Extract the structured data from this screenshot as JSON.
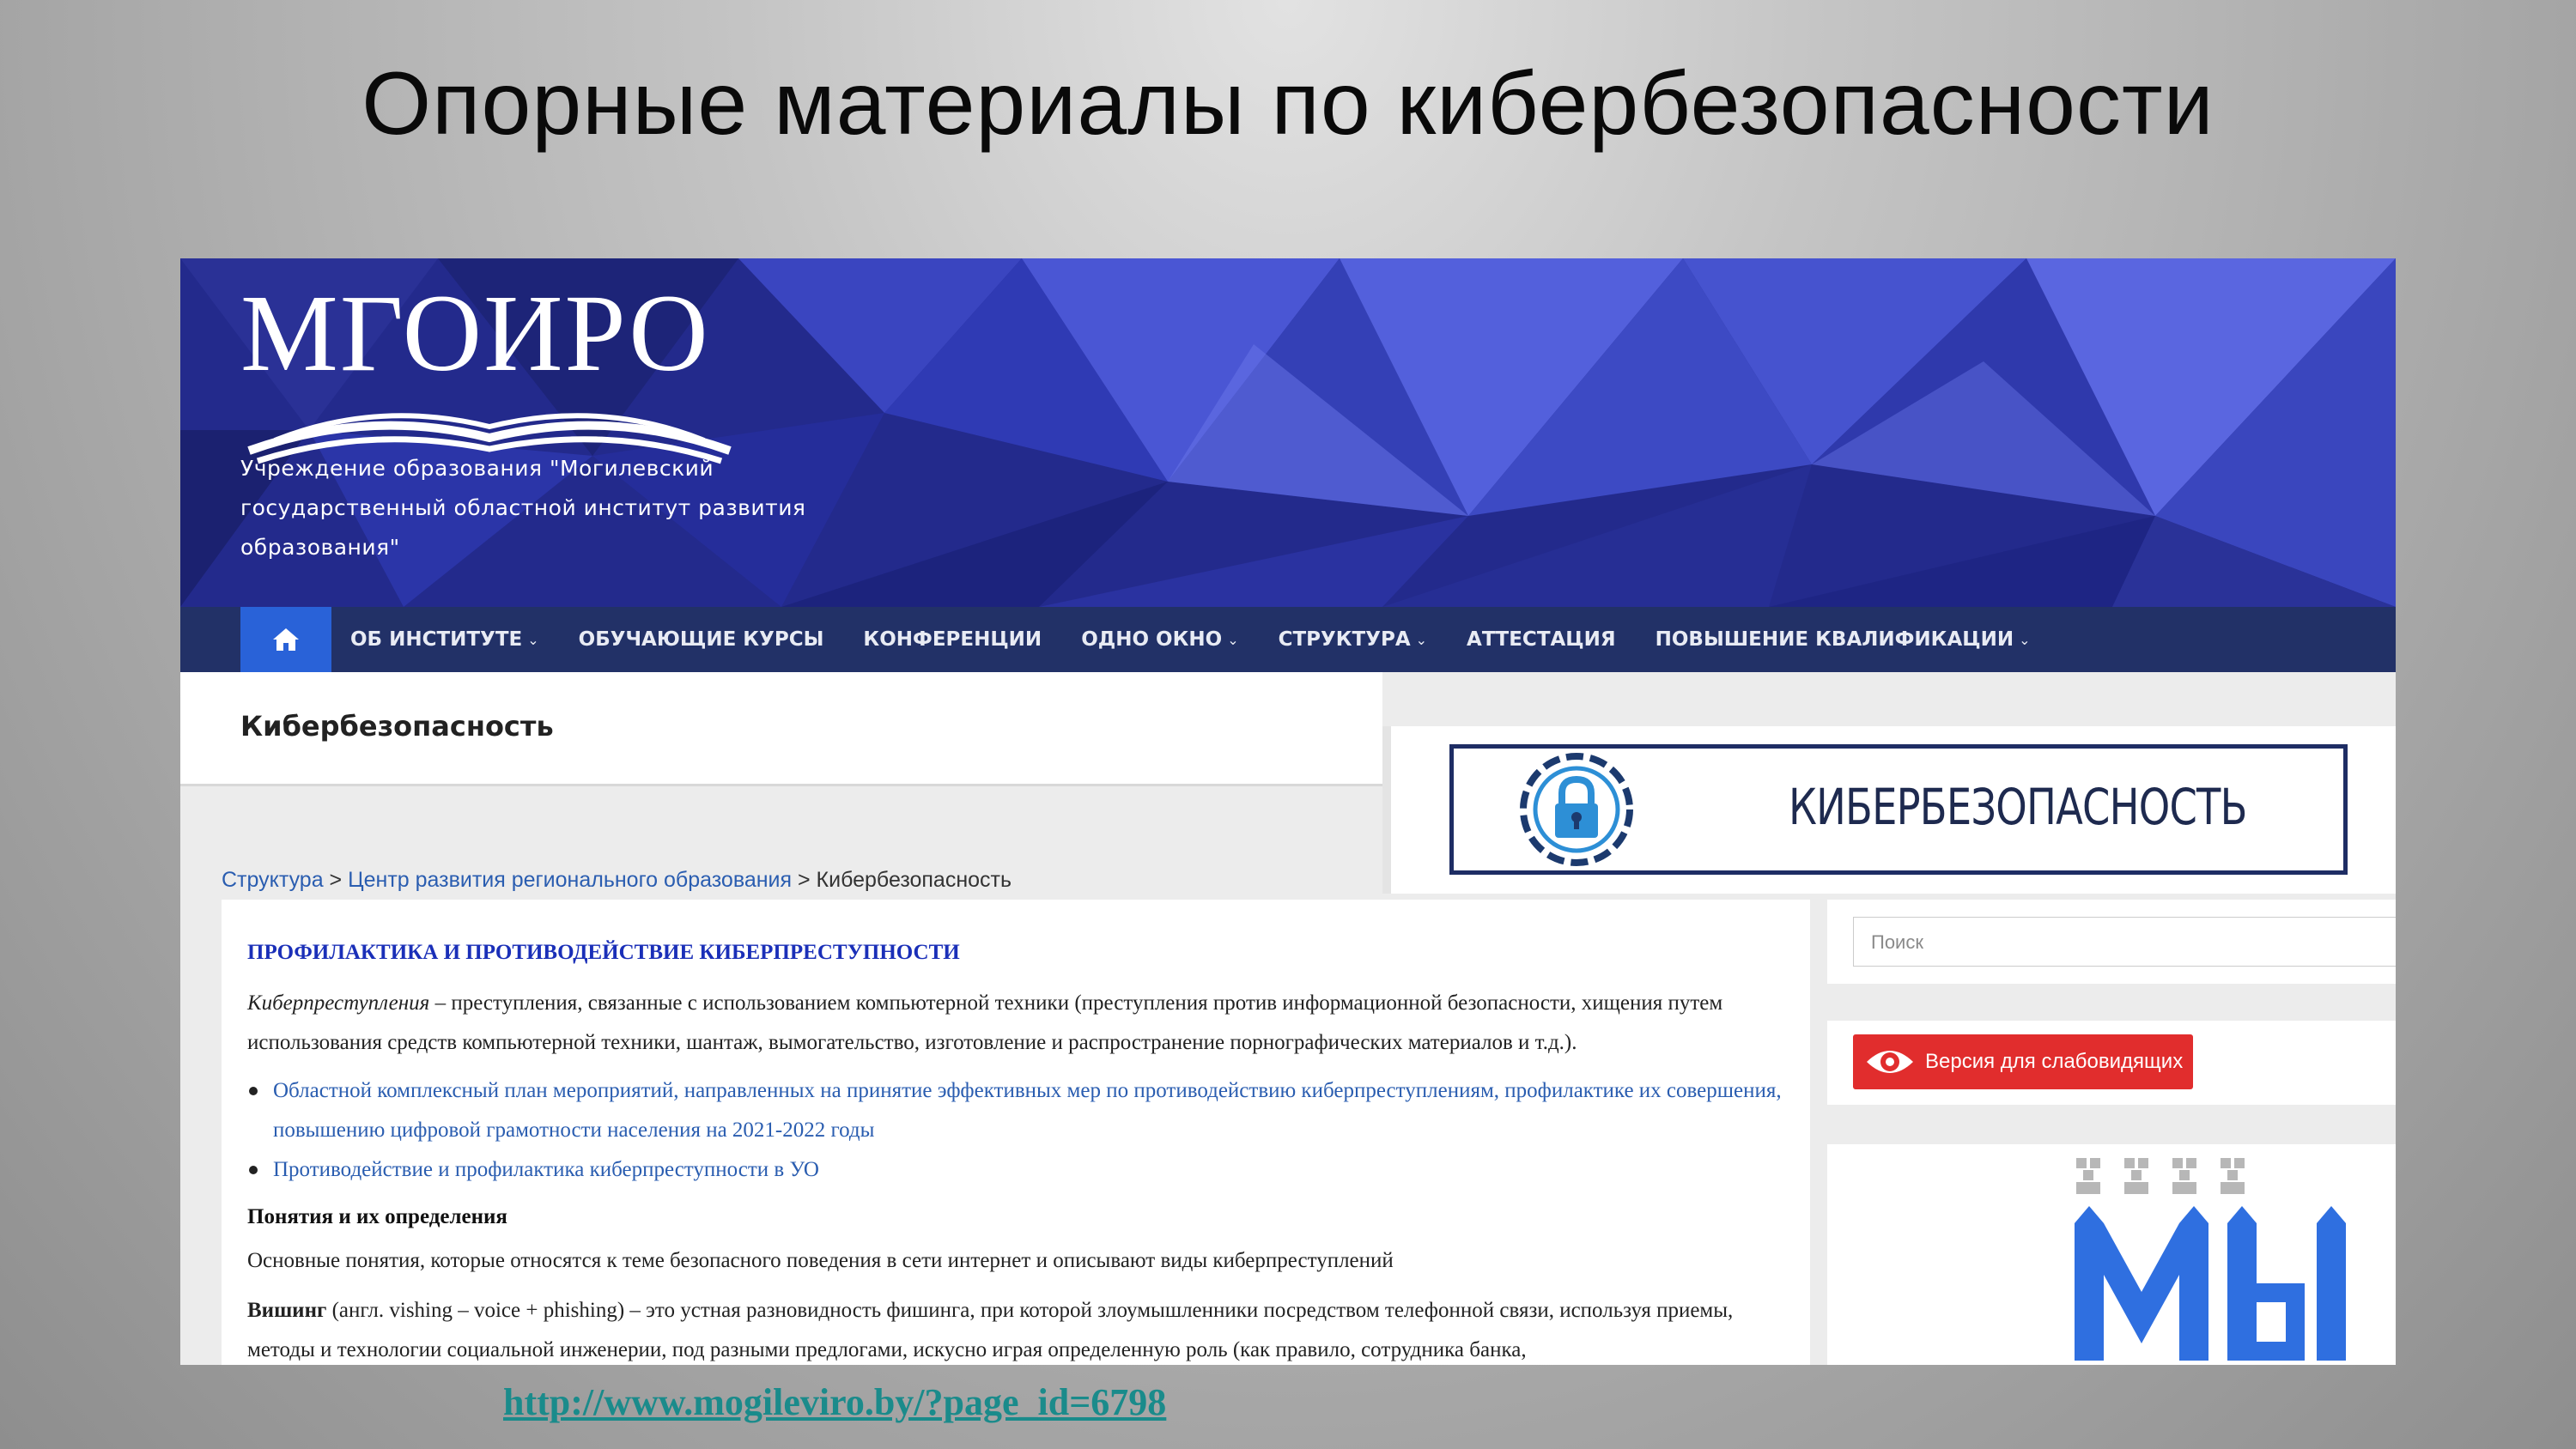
{
  "slide": {
    "title": "Опорные материалы по кибербезопасности",
    "url": "http://www.mogileviro.by/?page_id=6798"
  },
  "site": {
    "logo_text": "МГОИРО",
    "tagline": "Учреждение образования \"Могилевский государственный областной институт развития образования\"",
    "nav": {
      "home_icon": "home-icon",
      "items": [
        {
          "label": "ОБ ИНСТИТУТЕ",
          "dropdown": true
        },
        {
          "label": "ОБУЧАЮЩИЕ КУРСЫ",
          "dropdown": false
        },
        {
          "label": "КОНФЕРЕНЦИИ",
          "dropdown": false
        },
        {
          "label": "ОДНО ОКНО",
          "dropdown": true
        },
        {
          "label": "СТРУКТУРА",
          "dropdown": true
        },
        {
          "label": "АТТЕСТАЦИЯ",
          "dropdown": false
        },
        {
          "label": "ПОВЫШЕНИЕ КВАЛИФИКАЦИИ",
          "dropdown": true
        }
      ],
      "chevron": "⌄"
    },
    "page_title": "Кибербезопасность",
    "breadcrumb": {
      "items": [
        "Структура",
        "Центр развития регионального образования",
        "Кибербезопасность"
      ],
      "separator": " > "
    },
    "banner_text": "КИБЕРБЕЗОПАСНОСТЬ",
    "content": {
      "heading": "ПРОФИЛАКТИКА И ПРОТИВОДЕЙСТВИЕ КИБЕРПРЕСТУПНОСТИ",
      "intro_term": "Киберпреступления",
      "intro_text": " – преступления, связанные с использованием компьютерной техники (преступления против информационной безопасности, хищения путем использования средств компьютерной техники, шантаж, вымогательство, изготовление и распространение порнографических материалов и т.д.).",
      "links": [
        "Областной комплексный план мероприятий, направленных на принятие эффективных мер по противодействию киберпреступлениям, профилактике их совершения, повышению цифровой грамотности населения на 2021-2022 годы",
        "Противодействие и профилактика киберпреступности в УО"
      ],
      "concepts_heading": "Понятия и их определения",
      "concepts_text": "Основные понятия, которые относятся к теме безопасного поведения в сети интернет и описывают виды киберпреступлений",
      "vishing_term": "Вишинг",
      "vishing_text": " (англ. vishing – voice + phishing) – это устная разновидность фишинга, при которой злоумышленники посредством телефонной связи, используя приемы, методы и технологии социальной инженерии, под разными предлогами, искусно играя определенную роль (как правило, сотрудника банка,"
    },
    "sidebar": {
      "search_placeholder": "Поиск",
      "accessibility_button": "Версия для слабовидящих",
      "widget_text": "мы"
    }
  },
  "colors": {
    "nav_bg": "#223167",
    "home_bg": "#2962d8",
    "header_bg": "#232a8c",
    "link": "#2a5db0",
    "heading_blue": "#1a2fb8",
    "button_red": "#e12d2d",
    "url_teal": "#1a8b8b"
  }
}
